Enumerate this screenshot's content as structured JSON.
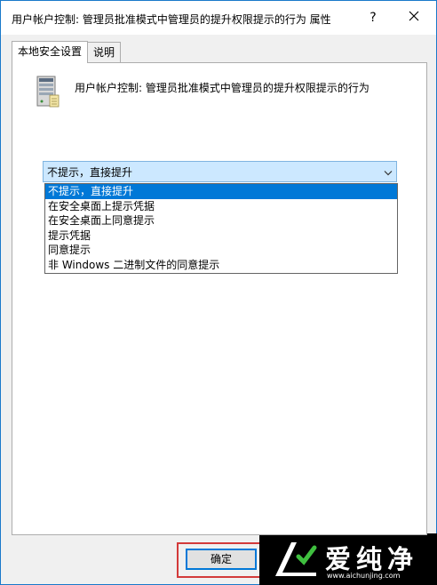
{
  "window": {
    "title": "用户帐户控制: 管理员批准模式中管理员的提升权限提示的行为 属性",
    "help_label": "?"
  },
  "tabs": [
    {
      "label": "本地安全设置",
      "active": true
    },
    {
      "label": "说明",
      "active": false
    }
  ],
  "policy": {
    "name": "用户帐户控制: 管理员批准模式中管理员的提升权限提示的行为",
    "icon": "server-computer-icon"
  },
  "combo": {
    "selected_value": "不提示，直接提升",
    "options": [
      "不提示，直接提升",
      "在安全桌面上提示凭据",
      "在安全桌面上同意提示",
      "提示凭据",
      "同意提示",
      "非 Windows 二进制文件的同意提示"
    ],
    "highlighted_index": 0
  },
  "buttons": {
    "ok_label": "确定"
  },
  "watermark": {
    "brand": "爱纯净",
    "url": "www.aichunjing.com"
  },
  "colors": {
    "accent": "#0078d7",
    "combo_bg": "#cce8ff",
    "highlight_box": "#d33a3a",
    "window_border": "#1979ca"
  }
}
